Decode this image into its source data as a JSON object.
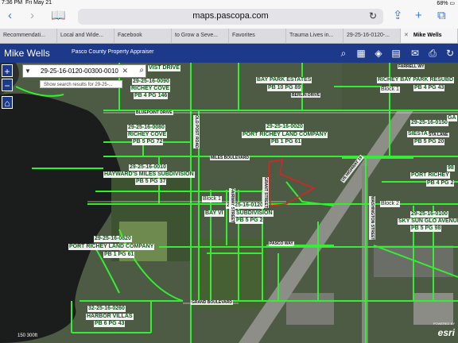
{
  "status": {
    "time": "7:36 PM",
    "date": "Fri May 21",
    "battery": "68%"
  },
  "browser": {
    "url": "maps.pascopa.com",
    "tabs": [
      "Recommendati...",
      "Local and Wide...",
      "Facebook",
      "to Grow a Seve...",
      "Favorites",
      "Trauma Lives in...",
      "29-25-16-0120-...",
      "Mike Wells"
    ]
  },
  "header": {
    "title": "Mike Wells",
    "subtitle": "Pasco County Property Appraiser"
  },
  "search": {
    "value": "29-25-16-0120-00300-0010",
    "suggestion": "Show search results for 29-25-..."
  },
  "map": {
    "parcel_labels": [
      "VIST DRIVE",
      "29-25-16-0090",
      "RICHEY COVE",
      "PB 4 PG 146",
      "BAY PARK ESTATES",
      "PB 10 PG 89",
      "BERLIN DRIVE",
      "FARRELL WY",
      "RICHEY BAY PARK RESUBD",
      "PB 4 PG 43",
      "29-25-16-0080",
      "RICHEY COVE",
      "PB 5 PG 72",
      "29-25-16-0020",
      "PORT RICHEY LAND COMPANY",
      "PB 1 PG 61",
      "29-25-16-0010",
      "HAYWARD'S MILES SUBDIVISION",
      "PB 5 PG 37",
      "Block 1",
      "29-25-16-0120",
      "SUBDIVISION",
      "PB 5 PG 2",
      "BAY VI",
      "29-25-16-0820",
      "PORT RICHEY LAND COMPANY",
      "PB 1 PG 61",
      "32-25-16-0260",
      "HARBOR VILLAS",
      "PB 6 PG 43",
      "SIESTA LANE",
      "PORT RICHEY",
      "SKY SUN GLO AVENUE",
      "PB 5 PG 98",
      "29-25-16-0100",
      "Block 1",
      "Block 2",
      "SIESTA",
      "PB 5 PG 20",
      "GA",
      "PB 4 PG 2",
      "29-25-16-0150",
      "98"
    ],
    "streets": [
      "BLUEPOINT DRIVE",
      "MILES BOULEVARD",
      "OLD POST ROAD",
      "PASCO WAY",
      "GRAND BOULEVARD",
      "FAIRWAY STREET",
      "WASHINGTON STREET",
      "US HIGHWAY 19",
      "GRANT STREET"
    ],
    "scale": "150 300ft",
    "attribution": "POWERED BY",
    "logo": "esri"
  },
  "icons": [
    "back-icon",
    "forward-icon",
    "book-icon",
    "reload-icon",
    "share-icon",
    "new-tab-icon",
    "tabs-icon",
    "search-icon",
    "grid-icon",
    "layers-icon",
    "measure-icon",
    "email-icon",
    "print-icon",
    "refresh-icon",
    "home-icon",
    "zoom-in-icon",
    "zoom-out-icon"
  ],
  "colors": {
    "header": "#1d3a8a",
    "parcel_line": "#33ee33",
    "selected_parcel": "#dd2222",
    "url_accent": "#2a7cf6"
  }
}
